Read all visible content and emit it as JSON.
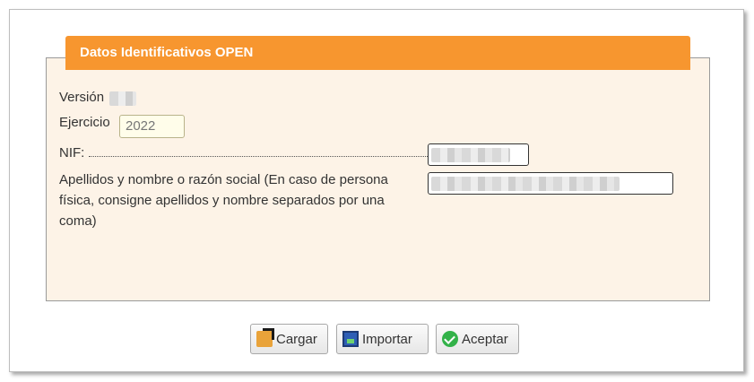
{
  "panel": {
    "title": "Datos Identificativos OPEN"
  },
  "form": {
    "version_label": "Versión",
    "ejercicio_label": "Ejercicio",
    "ejercicio_value": "2022",
    "nif_label": "NIF:",
    "apellidos_label": "Apellidos y nombre o razón social (En caso de persona física, consigne apellidos y nombre separados por una coma)"
  },
  "buttons": {
    "cargar": "Cargar",
    "importar": "Importar",
    "aceptar": "Aceptar"
  },
  "colors": {
    "header": "#f7962f",
    "panel_bg": "#fdf3e7",
    "year_field_bg": "#fffdea"
  },
  "icons": {
    "cargar": "upload-icon",
    "importar": "import-icon",
    "aceptar": "check-icon"
  }
}
